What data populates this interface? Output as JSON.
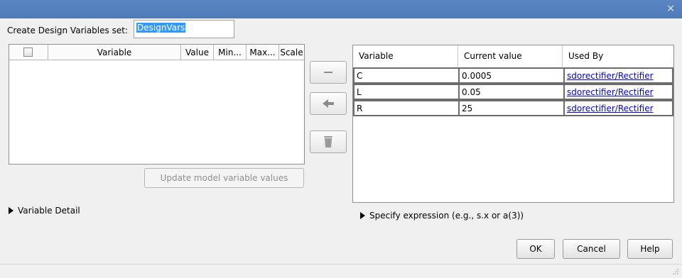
{
  "window": {
    "close_glyph": "×"
  },
  "set_name": {
    "label": "Create Design Variables set:",
    "value": "DesignVars"
  },
  "left_table": {
    "columns": [
      "Variable",
      "Value",
      "Min...",
      "Max...",
      "Scale"
    ]
  },
  "update_button": "Update model variable values",
  "variable_detail": "Variable Detail",
  "middle_buttons": {
    "remove_icon": "minus-icon",
    "move_left_icon": "left-arrow-icon",
    "delete_icon": "trash-icon"
  },
  "right_table": {
    "columns": [
      "Variable",
      "Current value",
      "Used By"
    ],
    "rows": [
      {
        "variable": "C",
        "value": "0.0005",
        "used_by": "sdorectifier/Rectifier"
      },
      {
        "variable": "L",
        "value": "0.05",
        "used_by": "sdorectifier/Rectifier"
      },
      {
        "variable": "R",
        "value": "25",
        "used_by": "sdorectifier/Rectifier"
      }
    ]
  },
  "specify_expression": "Specify expression (e.g., s.x or a(3))",
  "buttons": {
    "ok": "OK",
    "cancel": "Cancel",
    "help": "Help"
  }
}
